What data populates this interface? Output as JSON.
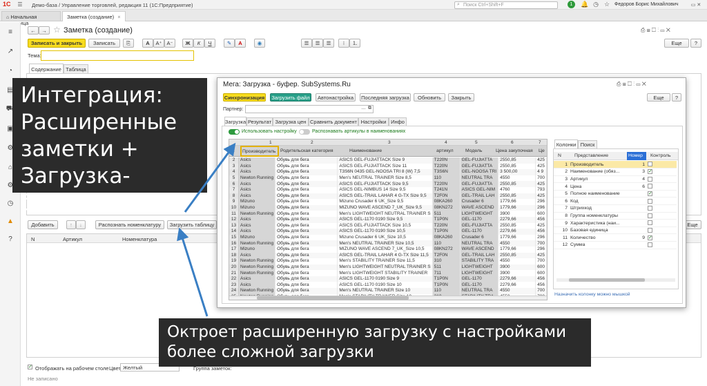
{
  "app": {
    "title": "Демо-база / Управление торговлей, редакция 11  (1С:Предприятие)",
    "search_placeholder": "Поиск Ctrl+Shift+F",
    "user": "Федоров Борис Михайлович",
    "notif_count": "1",
    "logo": "1С"
  },
  "tabs": {
    "home": "Начальная страница",
    "note": "Заметка (создание)"
  },
  "form": {
    "title": "Заметка (создание)",
    "save_close": "Записать и закрыть",
    "save": "Записать",
    "more": "Еще",
    "theme_label": "Тема:",
    "tab_content": "Содержание",
    "tab_table": "Таблица",
    "bold": "Ж",
    "italic": "К",
    "underline": "Ч",
    "font_a": "A",
    "font_up": "A⁺",
    "font_down": "A⁻"
  },
  "lower": {
    "add": "Добавить",
    "recognize": "Распознать номенклатуру",
    "load_table": "Загрузить таблицу",
    "more": "Еще",
    "col_n": "N",
    "col_article": "Артикул",
    "col_nomen": "Номенклатура"
  },
  "footer": {
    "show_desktop": "Отображать на рабочем столе",
    "color_label": "Цвет:",
    "color_value": "Желтый",
    "group_label": "Группа заметок:",
    "status": "Не записано"
  },
  "dialog": {
    "title": "Мега: Загрузка - буфер. SubSystems.Ru",
    "sync": "Синхронизация",
    "load_file": "Загрузить файл",
    "autoset": "Автонастройка",
    "last_load": "Последняя загрузка",
    "refresh": "Обновить",
    "close": "Закрыть",
    "more": "Еще",
    "partner_label": "Партнер:",
    "tabs": [
      "Загрузка",
      "Результат",
      "Загрузка цен",
      "Сравнить документ",
      "Настройки",
      "Инфо"
    ],
    "use_settings": "Использовать настройку",
    "recognize_articles": "Распознавать артикулы в наименованиях",
    "col_numbers": [
      "1",
      "2",
      "3",
      "4",
      "5",
      "6",
      "7"
    ],
    "headers": [
      "Производитель",
      "Родительская категория",
      "Наименование",
      "артикул",
      "Модель",
      "Цена закупочная",
      "Це"
    ],
    "rows": [
      [
        "2",
        "Asics",
        "Обувь для бега",
        "ASICS GEL-FUJIATTACK Size 9",
        "T220N",
        "GEL-FUJIATTA",
        "2550,85",
        "425"
      ],
      [
        "3",
        "Asics",
        "Обувь для бега",
        "ASICS GEL-FUJIATTACK Size 11",
        "T220N",
        "GEL-FUJIATTA",
        "2550,85",
        "425"
      ],
      [
        "4",
        "Asics",
        "Обувь для бега",
        "T3S6N 0435   GEL-NOOSA TRI 8 (W)  7,5",
        "T3S6N",
        "GEL-NOOSA TRI",
        "3 500,00",
        "4 9"
      ],
      [
        "5",
        "Newton Running",
        "Обувь для бега",
        "Men's NEUTRAL TRAINER Size 8,5",
        "110",
        "NEUTRAL TRA",
        "4550",
        "700"
      ],
      [
        "6",
        "Asics",
        "Обувь для бега",
        "ASICS GEL-FUJIATTACK Size 9,5",
        "T220N",
        "GEL-FUJIATTA",
        "2550,85",
        "425"
      ],
      [
        "7",
        "Asics",
        "Обувь для бега",
        "ASICS GEL-NIMBUS 14 Size 9,5",
        "T241N",
        "ASICS GEL-NIM",
        "4760",
        "793"
      ],
      [
        "8",
        "Asics",
        "Обувь для бега",
        "ASICS GEL-TRAIL LAHAR 4 G-TX Size 9,5",
        "T2F0N",
        "GEL-TRAIL LAH",
        "2550,85",
        "425"
      ],
      [
        "9",
        "Mizuno",
        "Обувь для бега",
        "Mizuno Crusader 6 UK_Size 9,5",
        "08KA260",
        "Crusader 6",
        "1779,66",
        "296"
      ],
      [
        "10",
        "Mizuno",
        "Обувь для бега",
        "MIZUNO WAVE ASCEND 7_UK_Size 9,5",
        "08KN272",
        "WAVE ASCEND",
        "1779,66",
        "296"
      ],
      [
        "11",
        "Newton Running",
        "Обувь для бега",
        "Men's LIGHTWEIGHT NEUTRAL TRAINER S",
        "511",
        "LIGHTWEIGHT",
        "3900",
        "600"
      ],
      [
        "12",
        "Asics",
        "Обувь для бега",
        "ASICS GEL-1170 0190 Size 9,5",
        "T1P0N",
        "GEL-1170",
        "2279,66",
        "456"
      ],
      [
        "13",
        "Asics",
        "Обувь для бега",
        "ASICS GEL-FUJIATTACK Size 10,5",
        "T220N",
        "GEL-FUJIATTA",
        "2550,85",
        "425"
      ],
      [
        "14",
        "Asics",
        "Обувь для бега",
        "ASICS GEL-1170 0190 Size 10,5",
        "T1P0N",
        "GEL-1170",
        "2279,66",
        "456"
      ],
      [
        "15",
        "Mizuno",
        "Обувь для бега",
        "Mizuno Crusader 6 UK_Size 10,5",
        "08KA260",
        "Crusader 6",
        "1779,66",
        "296"
      ],
      [
        "16",
        "Newton Running",
        "Обувь для бега",
        "Men's NEUTRAL TRAINER Size 10,5",
        "110",
        "NEUTRAL TRA",
        "4550",
        "700"
      ],
      [
        "17",
        "Mizuno",
        "Обувь для бега",
        "MIZUNO WAVE ASCEND 7_UK_Size 10,5",
        "08KN272",
        "WAVE ASCEND",
        "1779,66",
        "296"
      ],
      [
        "18",
        "Asics",
        "Обувь для бега",
        "ASICS GEL-TRAIL LAHAR 4 G-TX Size 11,5",
        "T2F0N",
        "GEL-TRAIL LAH",
        "2550,85",
        "425"
      ],
      [
        "19",
        "Newton Running",
        "Обувь для бега",
        "Men's STABILITY TRAINER Size 11,5",
        "310",
        "STABILITY TRA",
        "4550",
        "700"
      ],
      [
        "20",
        "Newton Running",
        "Обувь для бега",
        "Men's LIGHTWEIGHT NEUTRAL TRAINER S",
        "511",
        "LIGHTWEIGHT",
        "3900",
        "600"
      ],
      [
        "21",
        "Newton Running",
        "Обувь для бега",
        "Men's LIGHTWEIGHT STABILITY TRAINER",
        "711",
        "LIGHTWEIGHT",
        "3900",
        "600"
      ],
      [
        "22",
        "Asics",
        "Обувь для бега",
        "ASICS GEL-1170 0190 Size 9",
        "T1P0N",
        "GEL-1170",
        "2279,66",
        "456"
      ],
      [
        "23",
        "Asics",
        "Обувь для бега",
        "ASICS GEL-1170 0190 Size 10",
        "T1P0N",
        "GEL-1170",
        "2279,66",
        "456"
      ],
      [
        "24",
        "Newton Running",
        "Обувь для бега",
        "Men's NEUTRAL TRAINER Size 10",
        "110",
        "NEUTRAL TRA",
        "4550",
        "700"
      ],
      [
        "25",
        "Newton Running",
        "Обувь для бега",
        "Men's STABILITY TRAINER Size 10",
        "310",
        "STABILITY TRA",
        "4550",
        "700"
      ]
    ],
    "side_tabs": [
      "Колонки",
      "Поиск"
    ],
    "side_headers": [
      "N",
      "Представление",
      "Номер",
      "Контроль"
    ],
    "side_rows": [
      {
        "n": "1",
        "name": "Производитель",
        "num": "1",
        "check": false,
        "selected": true
      },
      {
        "n": "2",
        "name": "Наименование (обяз...",
        "num": "3",
        "check": true
      },
      {
        "n": "3",
        "name": "Артикул",
        "num": "4",
        "check": false
      },
      {
        "n": "4",
        "name": "Цена",
        "num": "6",
        "check": false
      },
      {
        "n": "5",
        "name": "Полное наименование",
        "num": "",
        "check": true
      },
      {
        "n": "6",
        "name": "Код",
        "num": "",
        "check": false
      },
      {
        "n": "7",
        "name": "Штрихкод",
        "num": "",
        "check": false
      },
      {
        "n": "8",
        "name": "Группа номенклатуры",
        "num": "",
        "check": false
      },
      {
        "n": "9",
        "name": "Характеристика (наи...",
        "num": "",
        "check": false
      },
      {
        "n": "10",
        "name": "Базовая единица",
        "num": "",
        "check": false
      },
      {
        "n": "11",
        "name": "Количество",
        "num": "9",
        "check": true
      },
      {
        "n": "12",
        "name": "Сумма",
        "num": "",
        "check": false
      }
    ],
    "assign_hint": "Назначить колонку можно мышкой"
  },
  "callouts": {
    "top_line1": "Интеграция:",
    "top_line2": "Расширенные",
    "top_line3": "заметки +",
    "top_line4": "Загрузка-буфер",
    "bottom_line1": "Октроет расширенную загрузку с настройками",
    "bottom_line2": "более сложной загрузки"
  },
  "colors": {
    "accent_yellow": "#f8dc1f",
    "teal": "#29a089",
    "callout_bg": "#2b2b2b",
    "arrow": "#3a7fc4"
  }
}
